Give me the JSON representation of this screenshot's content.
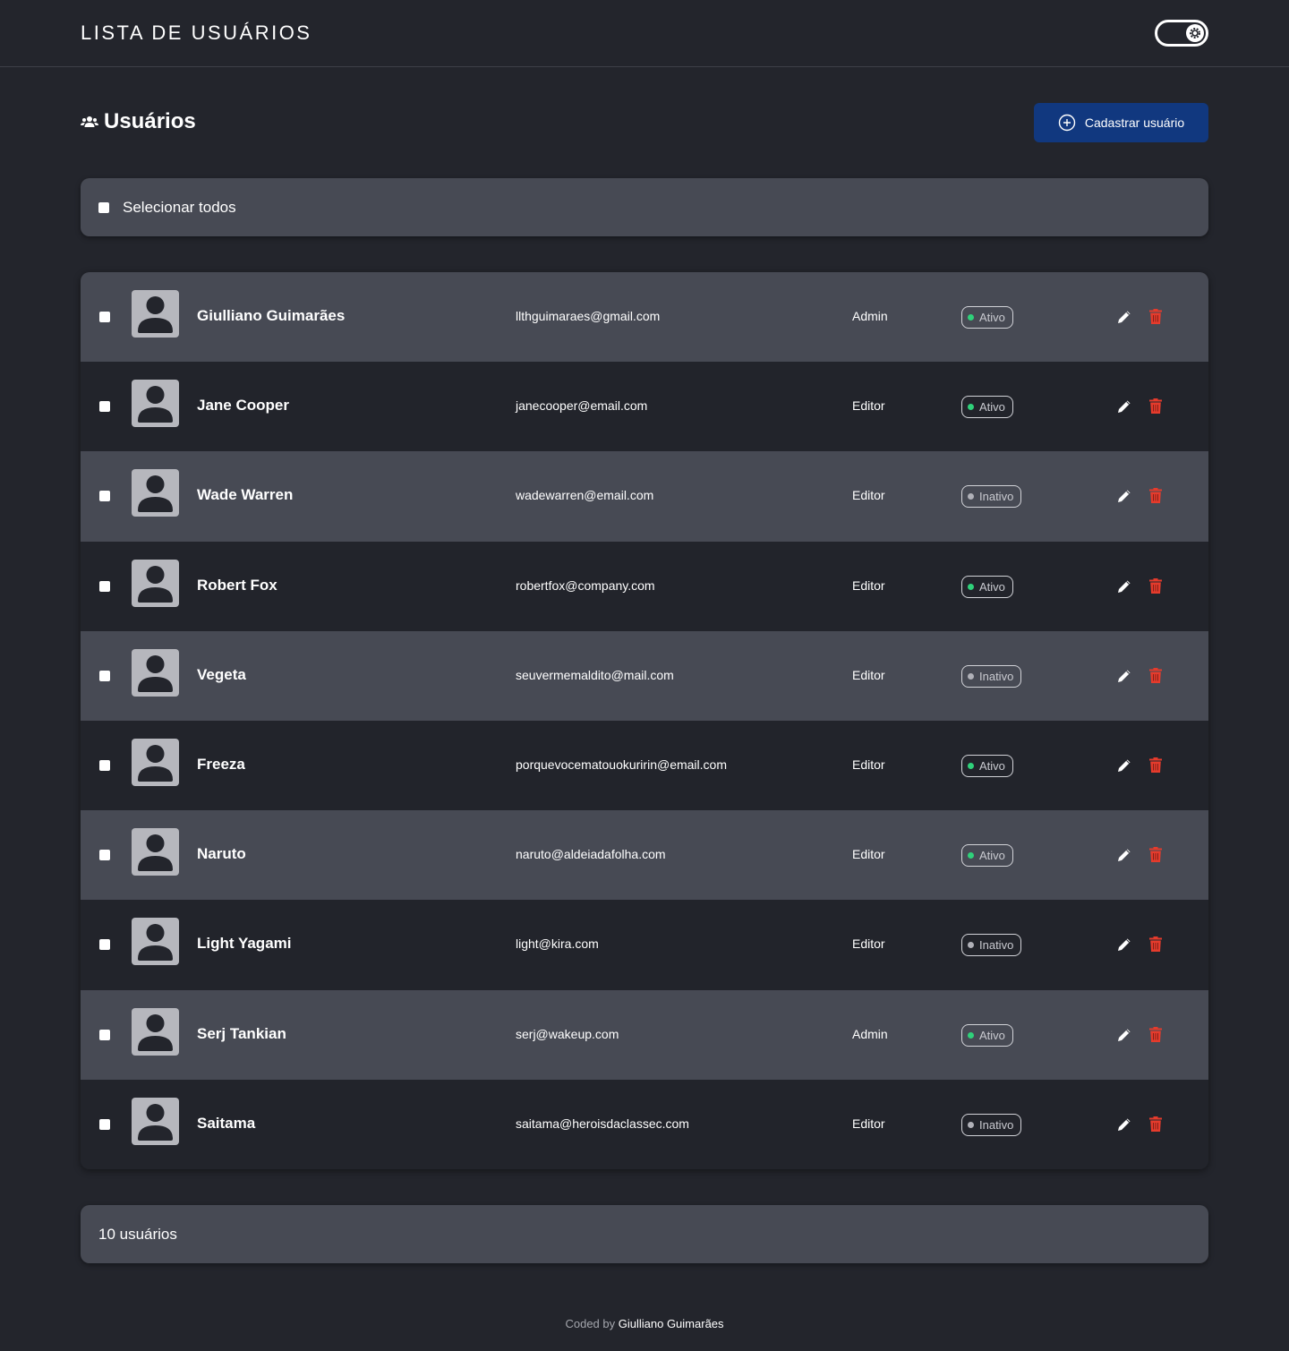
{
  "header": {
    "title": "LISTA DE USUÁRIOS",
    "theme_toggle_icon": "gear-icon"
  },
  "page": {
    "heading": "Usuários",
    "heading_icon": "users-icon",
    "add_button_label": "Cadastrar usuário",
    "add_button_icon": "plus-circle-icon"
  },
  "select_all": {
    "label": "Selecionar todos"
  },
  "colors": {
    "active_dot": "#2fd17a",
    "inactive_dot": "#b0b1b8",
    "delete": "#e53b2c",
    "accent": "#11387f"
  },
  "users": [
    {
      "name": "Giulliano Guimarães",
      "email": "llthguimaraes@gmail.com",
      "role": "Admin",
      "status": "Ativo",
      "active": true
    },
    {
      "name": "Jane Cooper",
      "email": "janecooper@email.com",
      "role": "Editor",
      "status": "Ativo",
      "active": true
    },
    {
      "name": "Wade Warren",
      "email": "wadewarren@email.com",
      "role": "Editor",
      "status": "Inativo",
      "active": false
    },
    {
      "name": "Robert Fox",
      "email": "robertfox@company.com",
      "role": "Editor",
      "status": "Ativo",
      "active": true
    },
    {
      "name": "Vegeta",
      "email": "seuvermemaldito@mail.com",
      "role": "Editor",
      "status": "Inativo",
      "active": false
    },
    {
      "name": "Freeza",
      "email": "porquevocematouokuririn@email.com",
      "role": "Editor",
      "status": "Ativo",
      "active": true
    },
    {
      "name": "Naruto",
      "email": "naruto@aldeiadafolha.com",
      "role": "Editor",
      "status": "Ativo",
      "active": true
    },
    {
      "name": "Light Yagami",
      "email": "light@kira.com",
      "role": "Editor",
      "status": "Inativo",
      "active": false
    },
    {
      "name": "Serj Tankian",
      "email": "serj@wakeup.com",
      "role": "Admin",
      "status": "Ativo",
      "active": true
    },
    {
      "name": "Saitama",
      "email": "saitama@heroisdaclassec.com",
      "role": "Editor",
      "status": "Inativo",
      "active": false
    }
  ],
  "summary": {
    "count_text": "10 usuários"
  },
  "footer": {
    "prefix": "Coded by",
    "author": "Giulliano Guimarães"
  }
}
